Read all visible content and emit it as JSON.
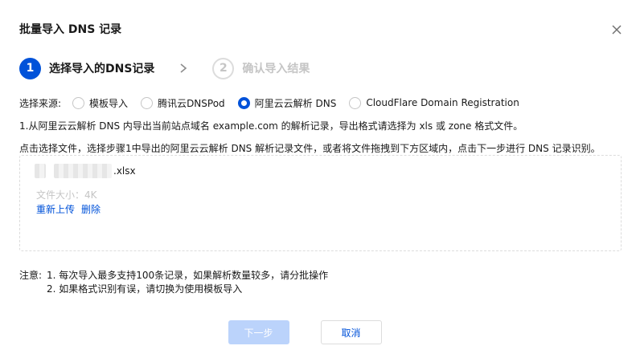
{
  "dialog": {
    "title": "批量导入 DNS 记录",
    "close_icon": "close-icon"
  },
  "steps": [
    {
      "number": "1",
      "label": "选择导入的DNS记录",
      "state": "active"
    },
    {
      "number": "2",
      "label": "确认导入结果",
      "state": "inactive"
    }
  ],
  "source": {
    "label": "选择来源:",
    "options": [
      {
        "label": "模板导入",
        "checked": false
      },
      {
        "label": "腾讯云DNSPod",
        "checked": false
      },
      {
        "label": "阿里云云解析 DNS",
        "checked": true
      },
      {
        "label": "CloudFlare Domain Registration",
        "checked": false
      }
    ]
  },
  "instructions": {
    "line1": "1.从阿里云云解析 DNS 内导出当前站点域名 example.com 的解析记录，导出格式请选择为 xls 或 zone 格式文件。",
    "line2": "点击选择文件，选择步骤1中导出的阿里云云解析 DNS 解析记录文件，或者将文件拖拽到下方区域内，点击下一步进行 DNS 记录识别。"
  },
  "file": {
    "extension": ".xlsx",
    "size_text": "文件大小：4K",
    "reupload": "重新上传",
    "delete": "删除"
  },
  "notes": {
    "label": "注意:",
    "items": [
      "1. 每次导入最多支持100条记录，如果解析数量较多，请分批操作",
      "2. 如果格式识别有误，请切换为使用模板导入"
    ]
  },
  "footer": {
    "next_label": "下一步",
    "cancel_label": "取消"
  },
  "colors": {
    "primary": "#0052d9",
    "primary_disabled": "#bbd3fb",
    "muted": "#c5c5c5"
  }
}
